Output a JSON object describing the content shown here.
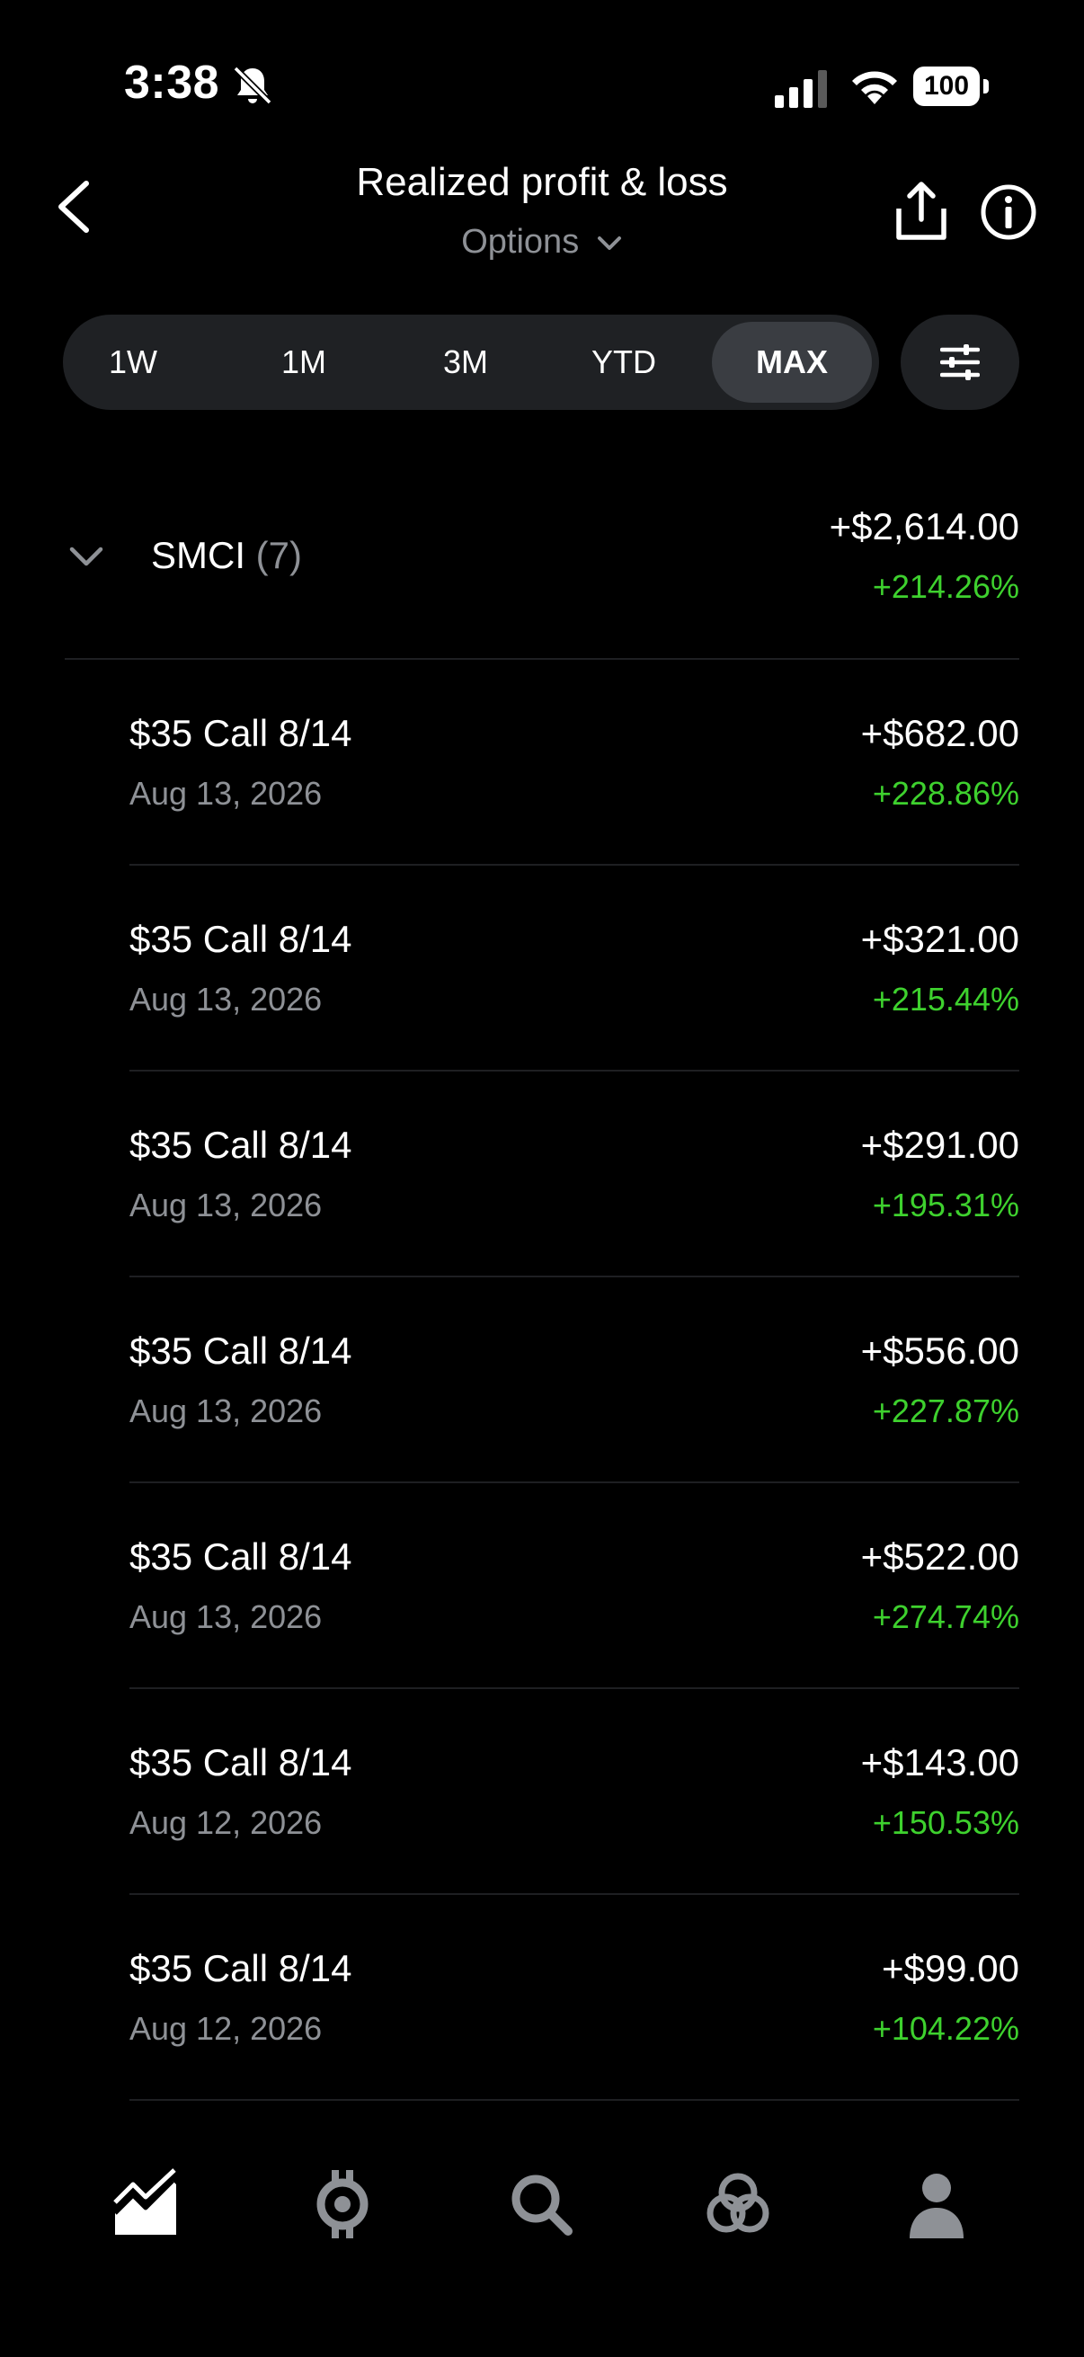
{
  "status_bar": {
    "time": "3:38",
    "battery": "100"
  },
  "header": {
    "title": "Realized profit & loss",
    "subtitle": "Options"
  },
  "range_tabs": [
    "1W",
    "1M",
    "3M",
    "YTD",
    "MAX"
  ],
  "active_range": "MAX",
  "group": {
    "symbol": "SMCI",
    "count": "(7)",
    "amount": "+$2,614.00",
    "percent": "+214.26%"
  },
  "rows": [
    {
      "name": "$35 Call 8/14",
      "date": "Aug 13, 2026",
      "amount": "+$682.00",
      "percent": "+228.86%"
    },
    {
      "name": "$35 Call 8/14",
      "date": "Aug 13, 2026",
      "amount": "+$321.00",
      "percent": "+215.44%"
    },
    {
      "name": "$35 Call 8/14",
      "date": "Aug 13, 2026",
      "amount": "+$291.00",
      "percent": "+195.31%"
    },
    {
      "name": "$35 Call 8/14",
      "date": "Aug 13, 2026",
      "amount": "+$556.00",
      "percent": "+227.87%"
    },
    {
      "name": "$35 Call 8/14",
      "date": "Aug 13, 2026",
      "amount": "+$522.00",
      "percent": "+274.74%"
    },
    {
      "name": "$35 Call 8/14",
      "date": "Aug 12, 2026",
      "amount": "+$143.00",
      "percent": "+150.53%"
    },
    {
      "name": "$35 Call 8/14",
      "date": "Aug 12, 2026",
      "amount": "+$99.00",
      "percent": "+104.22%"
    }
  ],
  "tab_bar": [
    "chart-icon",
    "crypto-icon",
    "search-icon",
    "network-icon",
    "account-icon"
  ],
  "colors": {
    "gain": "#3ed12e",
    "muted": "#8e9196",
    "background": "#000000"
  }
}
